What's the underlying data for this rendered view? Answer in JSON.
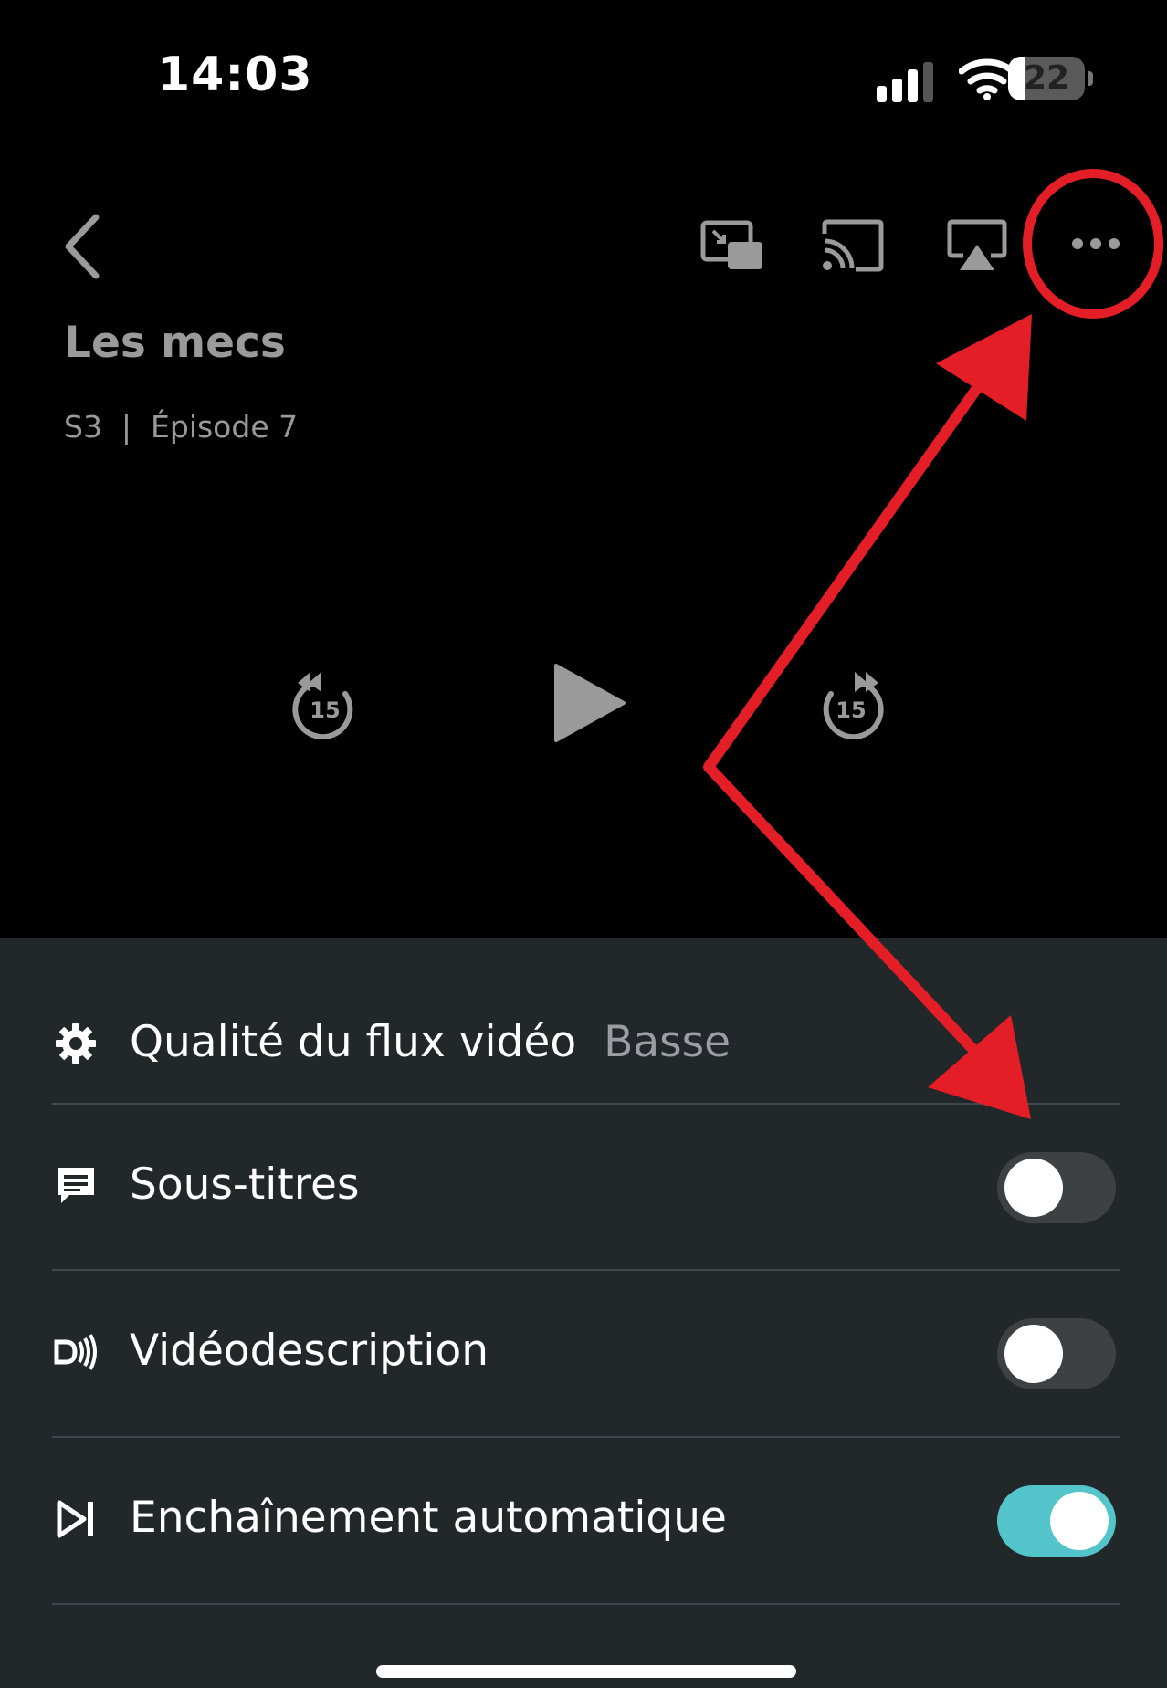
{
  "status_bar": {
    "time": "14:03",
    "battery_level": "22",
    "battery_fraction": 0.22,
    "icons": [
      "cellular-signal-icon",
      "wifi-icon",
      "battery-icon"
    ]
  },
  "top_controls": {
    "icons": [
      "chevron-left-icon",
      "picture-in-picture-icon",
      "cast-icon",
      "airplay-icon",
      "more-horizontal-icon"
    ]
  },
  "media": {
    "title": "Les mecs",
    "episode_info": "S3  |  Épisode 7"
  },
  "playback": {
    "rewind_seconds": "15",
    "forward_seconds": "15",
    "icons": [
      "rewind-15-icon",
      "play-icon",
      "forward-15-icon"
    ]
  },
  "settings": {
    "quality": {
      "label": "Qualité du flux vidéo",
      "value": "Basse",
      "icon": "gear-icon"
    },
    "subtitles": {
      "label": "Sous-titres",
      "enabled": false,
      "icon": "subtitles-icon"
    },
    "video_description": {
      "label": "Vidéodescription",
      "enabled": false,
      "icon": "audio-description-icon"
    },
    "autoplay": {
      "label": "Enchaînement automatique",
      "enabled": true,
      "icon": "skip-next-icon"
    }
  },
  "colors": {
    "background": "#000000",
    "sheet": "#222729",
    "toggle_on": "#54c4cb",
    "toggle_off": "#3d4144",
    "annotation": "#e41e26",
    "muted_text": "#9a9a9a"
  }
}
